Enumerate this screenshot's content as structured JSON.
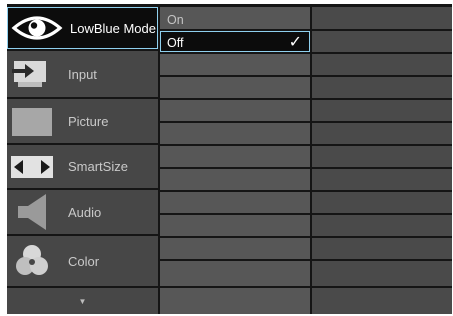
{
  "menu": {
    "items": [
      {
        "label": "LowBlue Mode",
        "icon": "eye-icon",
        "selected": true
      },
      {
        "label": "Input",
        "icon": "input-icon"
      },
      {
        "label": "Picture",
        "icon": "picture-icon"
      },
      {
        "label": "SmartSize",
        "icon": "smartsize-icon"
      },
      {
        "label": "Audio",
        "icon": "audio-icon"
      },
      {
        "label": "Color",
        "icon": "color-icon"
      }
    ],
    "scroll_down_glyph": "▼"
  },
  "options": {
    "items": [
      {
        "label": "On"
      },
      {
        "label": "Off",
        "selected": true
      }
    ],
    "check_glyph": "✓"
  },
  "colors": {
    "highlight_border": "#8fd0ee",
    "selected_bg": "#0c0c0c",
    "menu_bg": "#474747",
    "option_bg": "#575757"
  }
}
